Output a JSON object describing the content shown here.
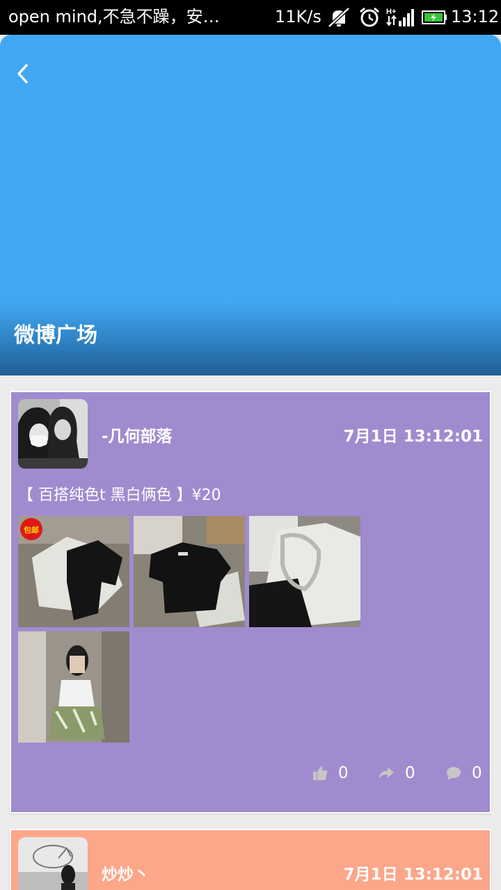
{
  "status_bar": {
    "notification_text": "open mind,不急不躁，安…",
    "net_speed": "11K/s",
    "clock": "13:12"
  },
  "header": {
    "title": "微博广场"
  },
  "posts": [
    {
      "username": "-几何部落",
      "time": "7月1日 13:12:01",
      "text": "【 百搭纯色t  黑白俩色 】¥20",
      "badge": "包邮",
      "likes": "0",
      "reposts": "0",
      "comments": "0",
      "bg_color": "#a08bcf"
    },
    {
      "username": "炒炒丶",
      "time": "7月1日 13:12:01",
      "bg_color": "#fca68a"
    }
  ]
}
